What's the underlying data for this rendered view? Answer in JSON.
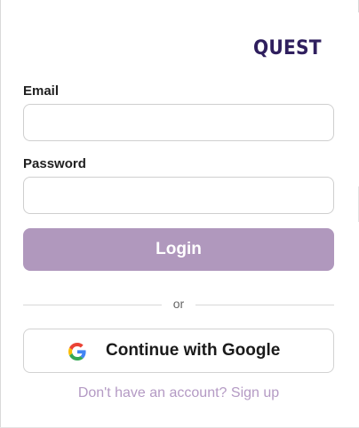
{
  "brand": {
    "logo_text": "QUEST",
    "logo_color": "#2f1f5e"
  },
  "form": {
    "email": {
      "label": "Email",
      "value": "",
      "placeholder": ""
    },
    "password": {
      "label": "Password",
      "value": "",
      "placeholder": ""
    },
    "login_button_label": "Login",
    "login_button_color": "#b098bd",
    "divider_text": "or",
    "google_button": {
      "label": "Continue with Google",
      "icon": "google-icon"
    },
    "signup_link_text": "Don't have an account? Sign up",
    "link_color": "#b49ac4"
  }
}
